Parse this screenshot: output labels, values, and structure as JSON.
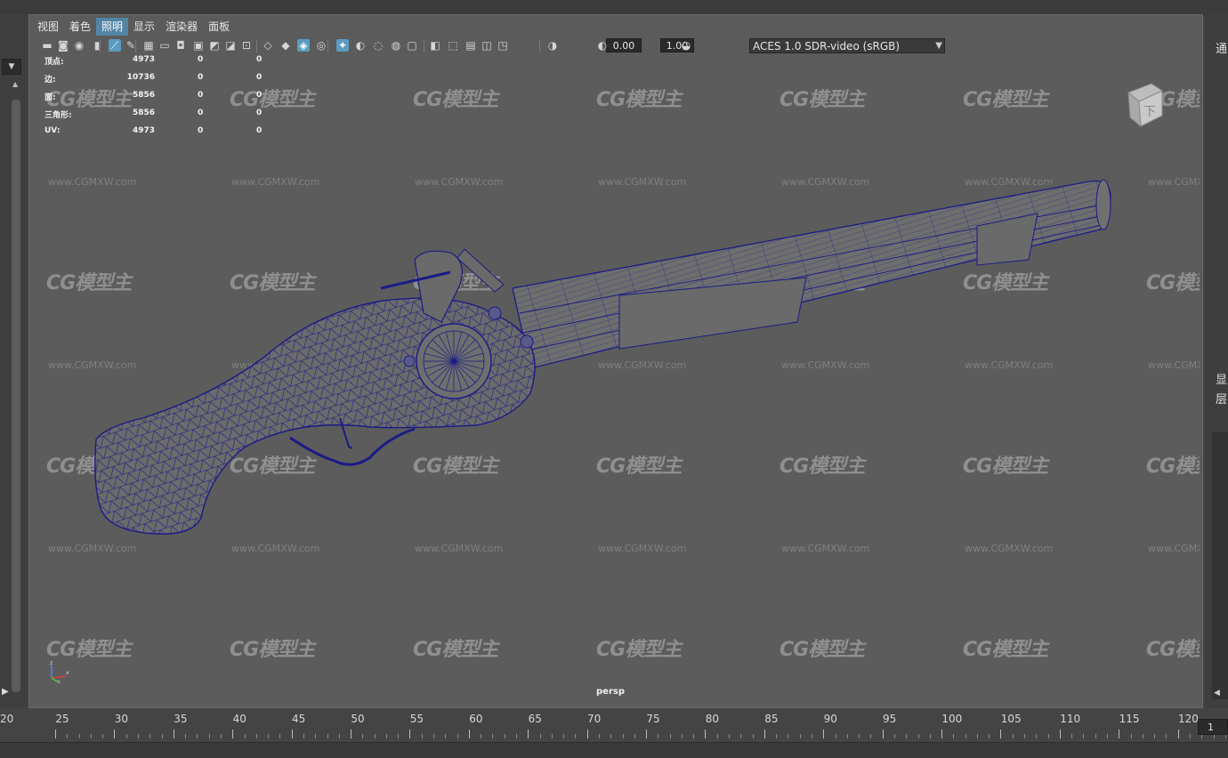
{
  "menu": {
    "items": [
      {
        "label": "视图",
        "active": false
      },
      {
        "label": "着色",
        "active": false
      },
      {
        "label": "照明",
        "active": true
      },
      {
        "label": "显示",
        "active": false
      },
      {
        "label": "渲染器",
        "active": false
      },
      {
        "label": "面板",
        "active": false
      }
    ]
  },
  "toolbar": {
    "exposure": "0.00",
    "gamma": "1.00",
    "color_management": "ACES 1.0 SDR-video (sRGB)",
    "icons": [
      "camera-icon",
      "camera-attributes-icon",
      "camera-bookmark-icon",
      "image-plane-icon",
      "2d-pan-zoom-icon",
      "grease-pencil-icon",
      "grid-icon",
      "film-gate-icon",
      "resolution-gate-icon",
      "gate-mask-icon",
      "field-chart-icon",
      "safe-action-icon",
      "safe-title-icon",
      "wireframe-icon",
      "smooth-shade-icon",
      "wireframe-on-shaded-icon",
      "textured-icon",
      "use-all-lights-icon",
      "shadows-icon",
      "screen-space-ao-icon",
      "motion-blur-icon",
      "anti-aliasing-icon",
      "depth-of-field-icon",
      "isolate-select-icon",
      "xray-icon",
      "xray-active-components-icon",
      "xray-joints-icon",
      "exposure-icon",
      "gamma-icon",
      "view-transform-icon"
    ]
  },
  "hud": {
    "rows": [
      {
        "label": "顶点:",
        "v1": "4973",
        "v2": "0",
        "v3": "0"
      },
      {
        "label": "边:",
        "v1": "10736",
        "v2": "0",
        "v3": "0"
      },
      {
        "label": "面:",
        "v1": "5856",
        "v2": "0",
        "v3": "0"
      },
      {
        "label": "三角形:",
        "v1": "5856",
        "v2": "0",
        "v3": "0"
      },
      {
        "label": "UV:",
        "v1": "4973",
        "v2": "0",
        "v3": "0"
      }
    ]
  },
  "viewport": {
    "camera_label": "persp",
    "view_cube_face": "下",
    "axis_labels": {
      "z": "z",
      "x": "x",
      "y": "y"
    }
  },
  "watermark": {
    "logo": "CG模型主",
    "url": "www.CGMXW.com"
  },
  "right_panel": {
    "top_char": "通",
    "mid_chars": [
      "显",
      "层"
    ]
  },
  "timeline": {
    "ticks": [
      "20",
      "25",
      "30",
      "35",
      "40",
      "45",
      "50",
      "55",
      "60",
      "65",
      "70",
      "75",
      "80",
      "85",
      "90",
      "95",
      "100",
      "105",
      "110",
      "115",
      "120"
    ],
    "current_frame": "1"
  },
  "colors": {
    "viewport_bg": "#5c5c5c",
    "wireframe": "#1a1a7a",
    "active_menu": "#5285a6",
    "icon_highlight": "#5a9bc0"
  }
}
